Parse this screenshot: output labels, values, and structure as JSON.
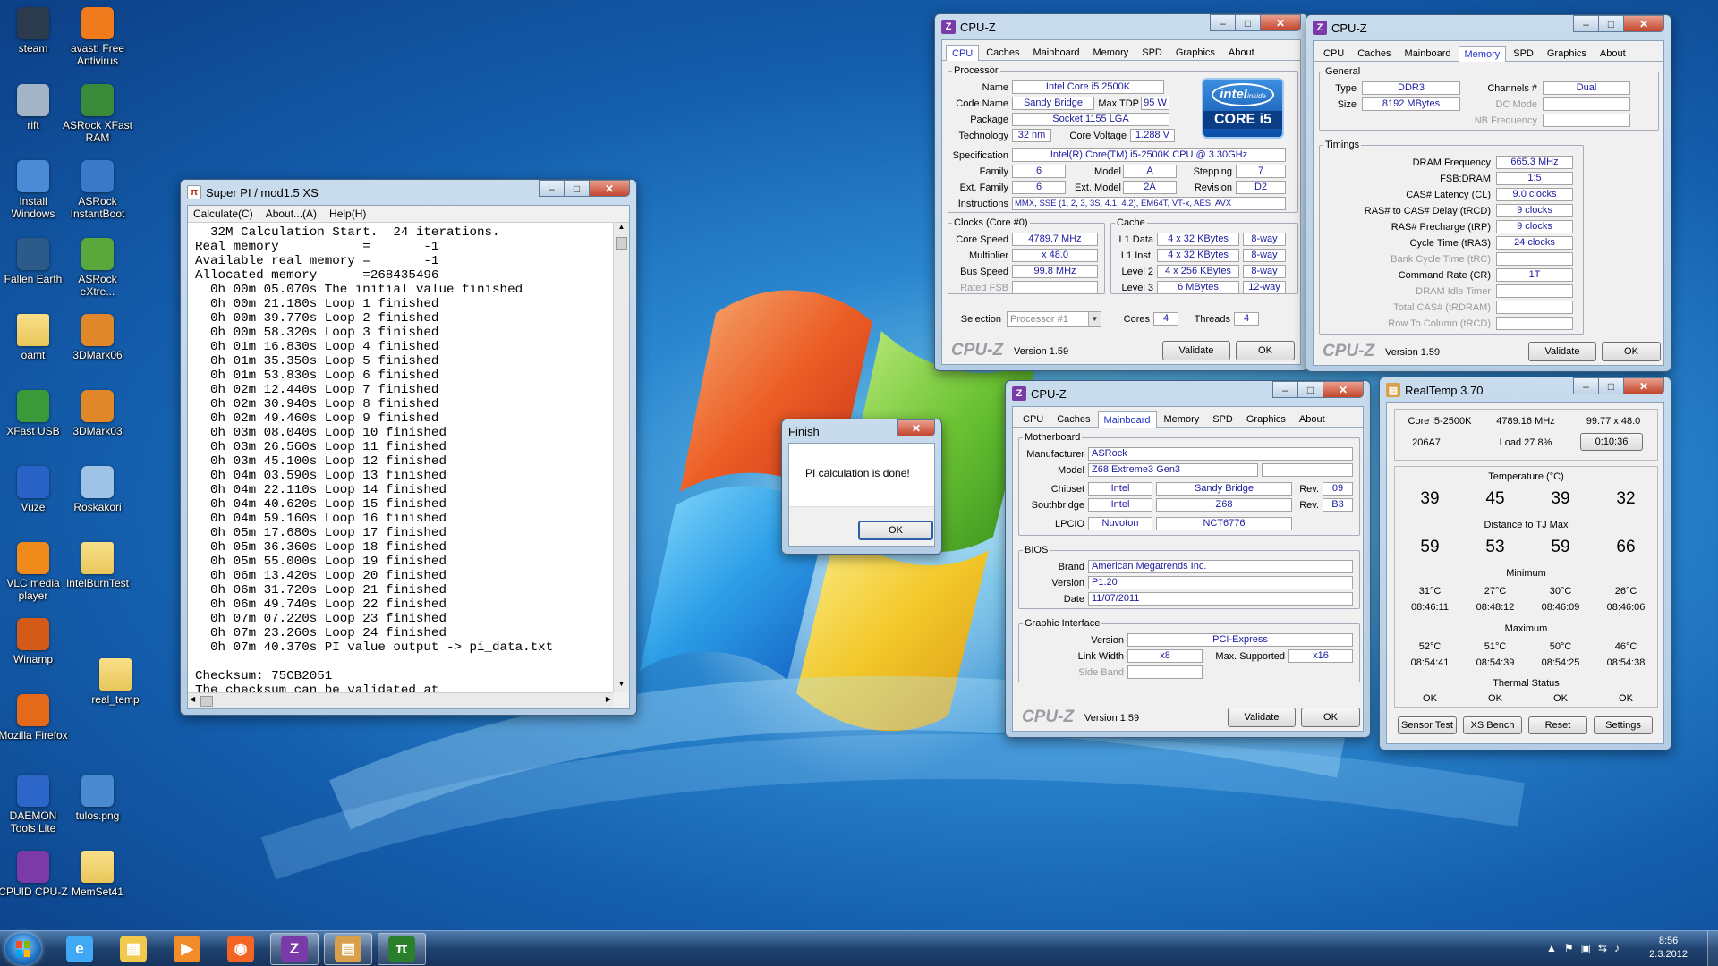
{
  "desktop": {
    "icons": [
      {
        "label": "steam",
        "icon": "steam-icon",
        "color": "#2b3a4c"
      },
      {
        "label": "avast! Free Antivirus",
        "icon": "avast-icon",
        "color": "#f07b1c"
      },
      {
        "label": "rift",
        "icon": "rift-icon",
        "color": "#a3b4c7"
      },
      {
        "label": "ASRock XFast RAM",
        "icon": "asrock-xfast-ram-icon",
        "color": "#3a8a3a"
      },
      {
        "label": "Install Windows",
        "icon": "install-windows-icon",
        "color": "#4b8bd6"
      },
      {
        "label": "ASRock InstantBoot",
        "icon": "asrock-instantboot-icon",
        "color": "#3a78c8"
      },
      {
        "label": "Fallen Earth",
        "icon": "fallen-earth-icon",
        "color": "#2c5b8a"
      },
      {
        "label": "ASRock eXtre...",
        "icon": "asrock-extreme-icon",
        "color": "#5aa83c"
      },
      {
        "label": "oamt",
        "icon": "folder-icon",
        "color": "#e9c65a"
      },
      {
        "label": "3DMark06",
        "icon": "3dmark06-icon",
        "color": "#e0872a"
      },
      {
        "label": "XFast USB",
        "icon": "xfast-usb-icon",
        "color": "#3a9a3a"
      },
      {
        "label": "3DMark03",
        "icon": "3dmark03-icon",
        "color": "#e0872a"
      },
      {
        "label": "Vuze",
        "icon": "vuze-icon",
        "color": "#2a63c8"
      },
      {
        "label": "Roskakori",
        "icon": "recycle-bin-icon",
        "color": "#9fc3e6"
      },
      {
        "label": "VLC media player",
        "icon": "vlc-icon",
        "color": "#f08a1a"
      },
      {
        "label": "IntelBurnTest",
        "icon": "folder-icon",
        "color": "#e9c65a"
      },
      {
        "label": "Winamp",
        "icon": "winamp-icon",
        "color": "#d45a1a"
      },
      {
        "label": "real_temp",
        "icon": "folder-icon",
        "color": "#e9c65a"
      },
      {
        "label": "Mozilla Firefox",
        "icon": "firefox-icon",
        "color": "#e46a1a"
      },
      {
        "label": "DAEMON Tools Lite",
        "icon": "daemon-tools-icon",
        "color": "#2c66c8"
      },
      {
        "label": "tulos.png",
        "icon": "image-file-icon",
        "color": "#4a8ad0"
      },
      {
        "label": "CPUID CPU-Z",
        "icon": "cpuz-icon",
        "color": "#7a3aa8"
      },
      {
        "label": "MemSet41",
        "icon": "folder-icon",
        "color": "#e9c65a"
      }
    ]
  },
  "superpi": {
    "title": "Super PI / mod1.5 XS",
    "menu": [
      "Calculate(C)",
      "About...(A)",
      "Help(H)"
    ],
    "lines": [
      "  32M Calculation Start.  24 iterations.",
      "Real memory           =       -1",
      "Available real memory =       -1",
      "Allocated memory      =268435496",
      "  0h 00m 05.070s The initial value finished",
      "  0h 00m 21.180s Loop 1 finished",
      "  0h 00m 39.770s Loop 2 finished",
      "  0h 00m 58.320s Loop 3 finished",
      "  0h 01m 16.830s Loop 4 finished",
      "  0h 01m 35.350s Loop 5 finished",
      "  0h 01m 53.830s Loop 6 finished",
      "  0h 02m 12.440s Loop 7 finished",
      "  0h 02m 30.940s Loop 8 finished",
      "  0h 02m 49.460s Loop 9 finished",
      "  0h 03m 08.040s Loop 10 finished",
      "  0h 03m 26.560s Loop 11 finished",
      "  0h 03m 45.100s Loop 12 finished",
      "  0h 04m 03.590s Loop 13 finished",
      "  0h 04m 22.110s Loop 14 finished",
      "  0h 04m 40.620s Loop 15 finished",
      "  0h 04m 59.160s Loop 16 finished",
      "  0h 05m 17.680s Loop 17 finished",
      "  0h 05m 36.360s Loop 18 finished",
      "  0h 05m 55.000s Loop 19 finished",
      "  0h 06m 13.420s Loop 20 finished",
      "  0h 06m 31.720s Loop 21 finished",
      "  0h 06m 49.740s Loop 22 finished",
      "  0h 07m 07.220s Loop 23 finished",
      "  0h 07m 23.260s Loop 24 finished",
      "  0h 07m 40.370s PI value output -> pi_data.txt",
      "",
      "Checksum: 75CB2051",
      "The checksum can be validated at"
    ]
  },
  "finish": {
    "title": "Finish",
    "message": "PI calculation is done!",
    "ok": "OK"
  },
  "cpuz_cpu": {
    "title": "CPU-Z",
    "tabs": [
      "CPU",
      "Caches",
      "Mainboard",
      "Memory",
      "SPD",
      "Graphics",
      "About"
    ],
    "processor_legend": "Processor",
    "name_label": "Name",
    "name": "Intel Core i5 2500K",
    "codename_label": "Code Name",
    "codename": "Sandy Bridge",
    "maxtdp_label": "Max TDP",
    "maxtdp": "95 W",
    "package_label": "Package",
    "package": "Socket 1155 LGA",
    "tech_label": "Technology",
    "tech": "32 nm",
    "corev_label": "Core Voltage",
    "corev": "1.288 V",
    "spec_label": "Specification",
    "spec": "Intel(R) Core(TM) i5-2500K CPU @ 3.30GHz",
    "family_label": "Family",
    "family": "6",
    "model_label": "Model",
    "model": "A",
    "stepping_label": "Stepping",
    "stepping": "7",
    "extfamily_label": "Ext. Family",
    "extfamily": "6",
    "extmodel_label": "Ext. Model",
    "extmodel": "2A",
    "revision_label": "Revision",
    "revision": "D2",
    "instr_label": "Instructions",
    "instr": "MMX, SSE (1, 2, 3, 3S, 4.1, 4.2), EM64T, VT-x, AES, AVX",
    "clocks_legend": "Clocks (Core #0)",
    "corespeed_label": "Core Speed",
    "corespeed": "4789.7 MHz",
    "mult_label": "Multiplier",
    "mult": "x 48.0",
    "bus_label": "Bus Speed",
    "bus": "99.8 MHz",
    "fsb_label": "Rated FSB",
    "fsb": "",
    "cache_legend": "Cache",
    "l1d_label": "L1 Data",
    "l1d": "4 x 32 KBytes",
    "l1d_way": "8-way",
    "l1i_label": "L1 Inst.",
    "l1i": "4 x 32 KBytes",
    "l1i_way": "8-way",
    "l2_label": "Level 2",
    "l2": "4 x 256 KBytes",
    "l2_way": "8-way",
    "l3_label": "Level 3",
    "l3": "6 MBytes",
    "l3_way": "12-way",
    "selection_label": "Selection",
    "selection": "Processor #1",
    "cores_label": "Cores",
    "cores": "4",
    "threads_label": "Threads",
    "threads": "4",
    "brand": "CPU-Z",
    "version": "Version 1.59",
    "validate": "Validate",
    "ok": "OK",
    "logo_intel": "intel",
    "logo_inside": "inside",
    "logo_core": "CORE i5"
  },
  "cpuz_mem": {
    "title": "CPU-Z",
    "tabs": [
      "CPU",
      "Caches",
      "Mainboard",
      "Memory",
      "SPD",
      "Graphics",
      "About"
    ],
    "general_legend": "General",
    "type_label": "Type",
    "type": "DDR3",
    "channels_label": "Channels #",
    "channels": "Dual",
    "size_label": "Size",
    "size": "8192 MBytes",
    "dcmode_label": "DC Mode",
    "dcmode": "",
    "nbfreq_label": "NB Frequency",
    "nbfreq": "",
    "timings_legend": "Timings",
    "timings": [
      {
        "label": "DRAM Frequency",
        "value": "665.3 MHz",
        "dim": false
      },
      {
        "label": "FSB:DRAM",
        "value": "1:5",
        "dim": false
      },
      {
        "label": "CAS# Latency (CL)",
        "value": "9.0 clocks",
        "dim": false
      },
      {
        "label": "RAS# to CAS# Delay (tRCD)",
        "value": "9 clocks",
        "dim": false
      },
      {
        "label": "RAS# Precharge (tRP)",
        "value": "9 clocks",
        "dim": false
      },
      {
        "label": "Cycle Time (tRAS)",
        "value": "24 clocks",
        "dim": false
      },
      {
        "label": "Bank Cycle Time (tRC)",
        "value": "",
        "dim": true
      },
      {
        "label": "Command Rate (CR)",
        "value": "1T",
        "dim": false
      },
      {
        "label": "DRAM Idle Timer",
        "value": "",
        "dim": true
      },
      {
        "label": "Total CAS# (tRDRAM)",
        "value": "",
        "dim": true
      },
      {
        "label": "Row To Column (tRCD)",
        "value": "",
        "dim": true
      }
    ],
    "brand": "CPU-Z",
    "version": "Version 1.59",
    "validate": "Validate",
    "ok": "OK"
  },
  "cpuz_mb": {
    "title": "CPU-Z",
    "tabs": [
      "CPU",
      "Caches",
      "Mainboard",
      "Memory",
      "SPD",
      "Graphics",
      "About"
    ],
    "mb_legend": "Motherboard",
    "manu_label": "Manufacturer",
    "manu": "ASRock",
    "model_label": "Model",
    "model": "Z68 Extreme3 Gen3",
    "model2": "",
    "chipset_label": "Chipset",
    "chipset_vendor": "Intel",
    "chipset": "Sandy Bridge",
    "chipset_rev_label": "Rev.",
    "chipset_rev": "09",
    "south_label": "Southbridge",
    "south_vendor": "Intel",
    "south": "Z68",
    "south_rev_label": "Rev.",
    "south_rev": "B3",
    "lpcio_label": "LPCIO",
    "lpcio_vendor": "Nuvoton",
    "lpcio": "NCT6776",
    "bios_legend": "BIOS",
    "brand_label": "Brand",
    "bios_brand": "American Megatrends Inc.",
    "version_label": "Version",
    "bios_version": "P1.20",
    "date_label": "Date",
    "bios_date": "11/07/2011",
    "gfx_legend": "Graphic Interface",
    "gver_label": "Version",
    "gver": "PCI-Express",
    "lw_label": "Link Width",
    "lw": "x8",
    "maxsup_label": "Max. Supported",
    "maxsup": "x16",
    "side_label": "Side Band",
    "side": "",
    "brand": "CPU-Z",
    "version": "Version 1.59",
    "validate": "Validate",
    "ok": "OK"
  },
  "realtemp": {
    "title": "RealTemp 3.70",
    "cpu": "Core i5-2500K",
    "freq": "4789.16 MHz",
    "mult": "99.77 x 48.0",
    "id": "206A7",
    "load": "Load  27.8%",
    "timer": "0:10:36",
    "temp_title": "Temperature (°C)",
    "temps": [
      "39",
      "45",
      "39",
      "32"
    ],
    "dist_title": "Distance to TJ Max",
    "dists": [
      "59",
      "53",
      "59",
      "66"
    ],
    "min_title": "Minimum",
    "mins": [
      "31°C",
      "27°C",
      "30°C",
      "26°C"
    ],
    "min_times": [
      "08:46:11",
      "08:48:12",
      "08:46:09",
      "08:46:06"
    ],
    "max_title": "Maximum",
    "maxs": [
      "52°C",
      "51°C",
      "50°C",
      "46°C"
    ],
    "max_times": [
      "08:54:41",
      "08:54:39",
      "08:54:25",
      "08:54:38"
    ],
    "status_title": "Thermal Status",
    "status": [
      "OK",
      "OK",
      "OK",
      "OK"
    ],
    "buttons": [
      "Sensor Test",
      "XS Bench",
      "Reset",
      "Settings"
    ]
  },
  "taskbar": {
    "items": [
      {
        "icon": "ie-icon",
        "active": false
      },
      {
        "icon": "explorer-icon",
        "active": false
      },
      {
        "icon": "media-player-icon",
        "active": false
      },
      {
        "icon": "firefox-icon",
        "active": false
      },
      {
        "icon": "cpuz-icon",
        "active": true
      },
      {
        "icon": "realtemp-icon",
        "active": true
      },
      {
        "icon": "superpi-icon",
        "active": true
      }
    ],
    "time": "8:56",
    "date": "2.3.2012"
  },
  "colors": {
    "cpuz_value": "#1b1b9e",
    "intel_blue": "#0a64b8",
    "superpi_red": "#b8331c"
  }
}
